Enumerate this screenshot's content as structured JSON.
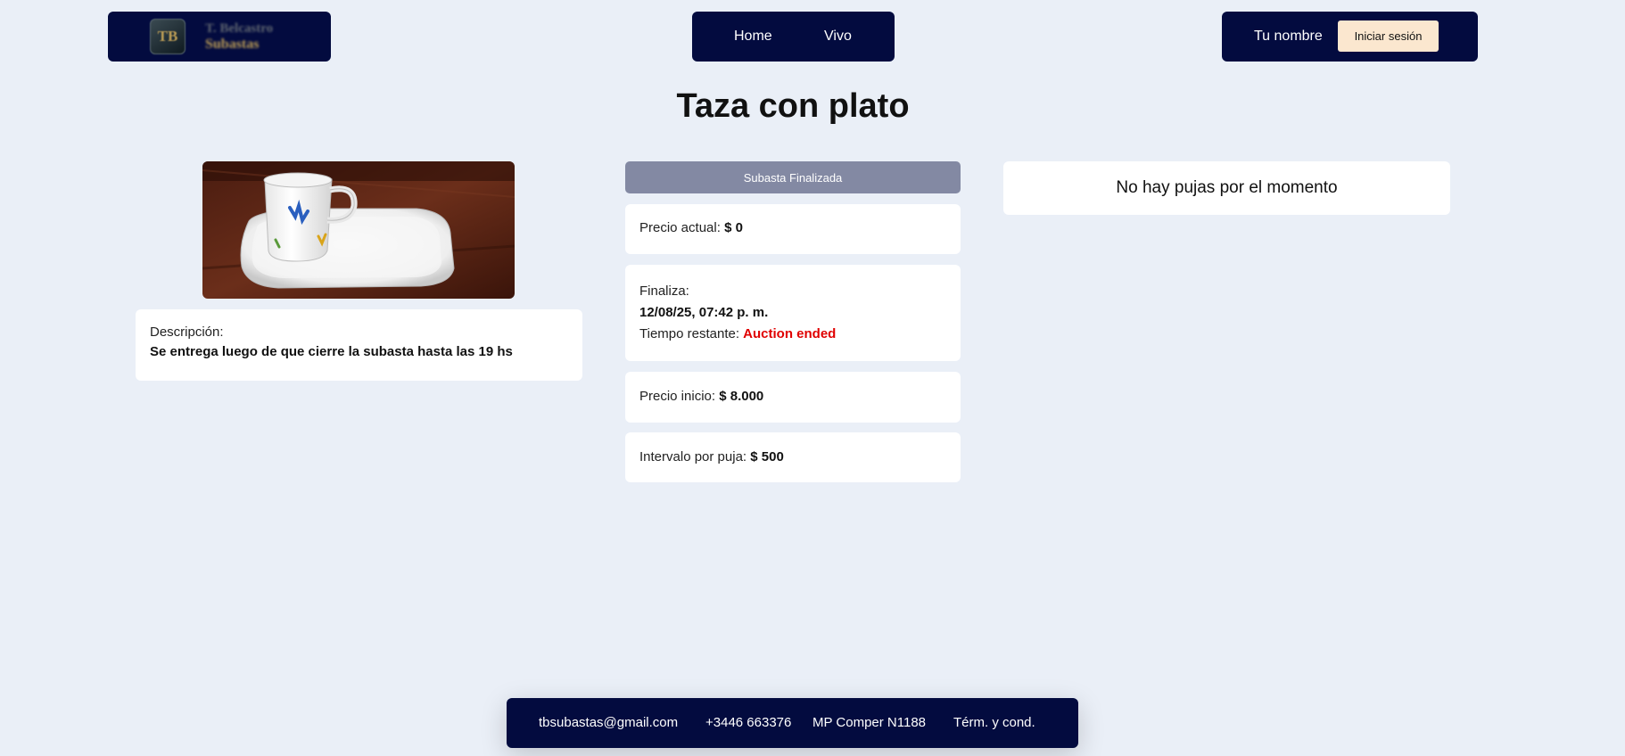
{
  "header": {
    "logo": {
      "mark": "TB",
      "line1": "T. Belcastro",
      "line2": "Subastas"
    },
    "nav": [
      {
        "label": "Home"
      },
      {
        "label": "Vivo"
      }
    ],
    "user": {
      "name": "Tu nombre",
      "login_label": "Iniciar sesión"
    }
  },
  "product": {
    "title": "Taza con plato",
    "image_alt": "Taza con plato",
    "description_label": "Descripción:",
    "description": "Se entrega luego de que cierre la subasta hasta las 19 hs"
  },
  "auction": {
    "status": "Subasta Finalizada",
    "current_price_label": "Precio actual:",
    "current_price": "$ 0",
    "ends_label": "Finaliza:",
    "ends_value": "12/08/25, 07:42 p. m.",
    "remaining_label": "Tiempo restante:",
    "remaining_value": "Auction ended",
    "start_price_label": "Precio inicio:",
    "start_price": "$ 8.000",
    "interval_label": "Intervalo por puja:",
    "interval": "$ 500"
  },
  "bids": {
    "empty_message": "No hay pujas por el momento"
  },
  "footer": {
    "email": "tbsubastas@gmail.com",
    "phone": "+3446 663376",
    "license": "MP Comper N1188",
    "terms": "Térm. y cond."
  },
  "colors": {
    "navy": "#030b3f",
    "background": "#eaeff7",
    "status_bar": "#8389a3",
    "login_button": "#fbe7cf",
    "ended_red": "#e00000"
  }
}
